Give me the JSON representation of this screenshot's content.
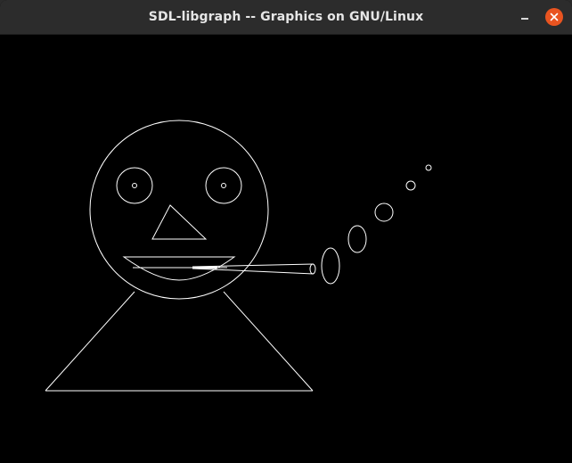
{
  "window": {
    "title": "SDL-libgraph -- Graphics on GNU/Linux",
    "accent_close": "#e95420"
  },
  "icons": {
    "minimize": "minimize-icon",
    "close": "close-icon"
  },
  "canvas": {
    "background": "#000000",
    "stroke": "#ffffff"
  }
}
